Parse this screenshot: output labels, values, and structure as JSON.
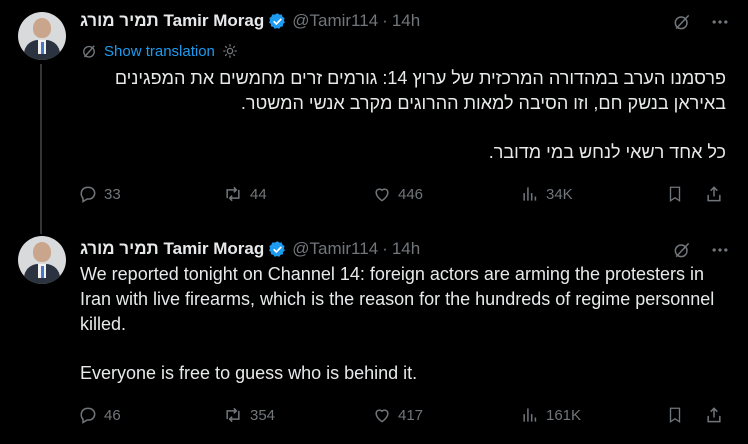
{
  "tweets": [
    {
      "author_name": "תמיר מורג Tamir Morag",
      "handle": "@Tamir114",
      "time": "14h",
      "show_translation": "Show translation",
      "paragraphs": [
        "פרסמנו הערב במהדורה המרכזית של ערוץ 14: גורמים זרים מחמשים את המפגינים באיראן בנשק חם, וזו הסיבה למאות ההרוגים מקרב אנשי המשטר.",
        "כל אחד רשאי לנחש במי מדובר."
      ],
      "replies": "33",
      "reposts": "44",
      "likes": "446",
      "views": "34K"
    },
    {
      "author_name": "תמיר מורג Tamir Morag",
      "handle": "@Tamir114",
      "time": "14h",
      "paragraphs": [
        "We reported tonight on Channel 14: foreign actors are arming the protesters in Iran with live firearms, which is the reason for the hundreds of regime personnel killed.",
        "Everyone is free to guess who is behind it."
      ],
      "replies": "46",
      "reposts": "354",
      "likes": "417",
      "views": "161K"
    }
  ],
  "icons": {
    "verified": "verified-badge-icon",
    "grok": "grok-icon",
    "more": "more-icon",
    "reply": "reply-icon",
    "repost": "repost-icon",
    "like": "like-icon",
    "views": "views-icon",
    "bookmark": "bookmark-icon",
    "share": "share-icon"
  },
  "colors": {
    "background": "#000000",
    "text": "#e7e9ea",
    "muted": "#71767b",
    "accent": "#1d9bf0"
  }
}
